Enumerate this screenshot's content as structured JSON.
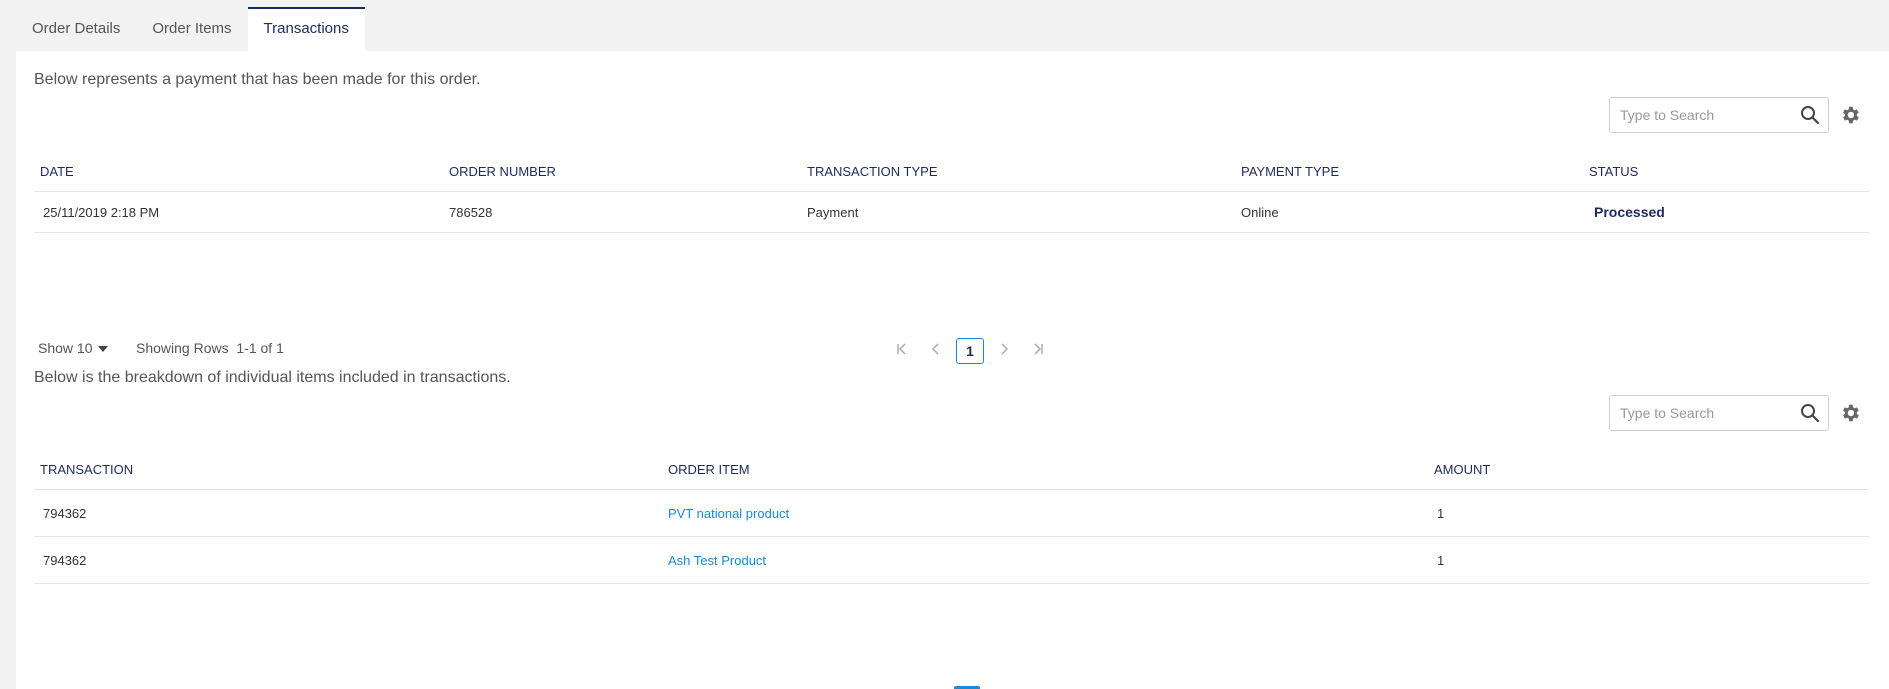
{
  "tabs": [
    {
      "label": "Order Details"
    },
    {
      "label": "Order Items"
    },
    {
      "label": "Transactions"
    }
  ],
  "payments": {
    "description": "Below represents a payment that has been made for this order.",
    "search_placeholder": "Type to Search",
    "columns": [
      "DATE",
      "ORDER NUMBER",
      "TRANSACTION TYPE",
      "PAYMENT TYPE",
      "STATUS"
    ],
    "rows": [
      {
        "date": "25/11/2019 2:18 PM",
        "order_number": "786528",
        "transaction_type": "Payment",
        "payment_type": "Online",
        "status": "Processed"
      }
    ],
    "show_label": "Show 10",
    "showing_label": "Showing Rows",
    "showing_range": "1-1 of 1",
    "current_page": "1"
  },
  "breakdown": {
    "description": "Below is the breakdown of individual items included in transactions.",
    "search_placeholder": "Type to Search",
    "columns": [
      "TRANSACTION",
      "ORDER ITEM",
      "AMOUNT"
    ],
    "rows": [
      {
        "transaction": "794362",
        "order_item": "PVT national product",
        "amount": "1"
      },
      {
        "transaction": "794362",
        "order_item": "Ash Test Product",
        "amount": "1"
      }
    ]
  },
  "colors": {
    "accent": "#1d2a5c",
    "link": "#1b8ad6"
  },
  "icons": [
    "search-icon",
    "gear-icon",
    "first-page-icon",
    "prev-page-icon",
    "next-page-icon",
    "last-page-icon",
    "caret-down-icon"
  ]
}
